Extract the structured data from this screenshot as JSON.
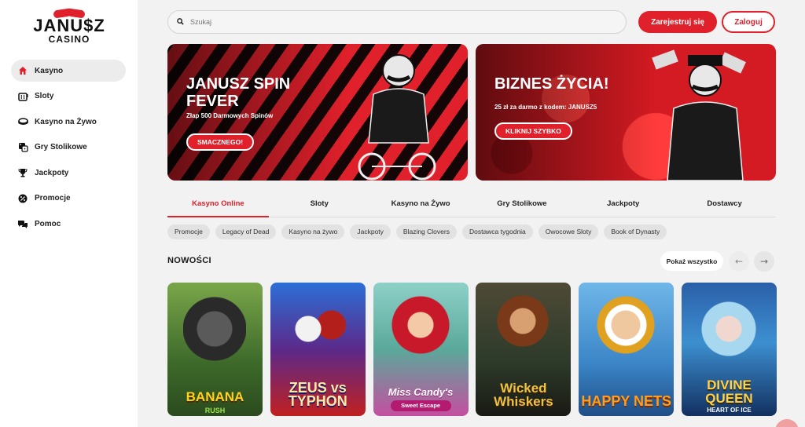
{
  "brand": {
    "line1": "JANU$Z",
    "line2": "CASINO",
    "accent": "#e0202b"
  },
  "sidebar": {
    "items": [
      {
        "label": "Kasyno",
        "icon": "home-icon",
        "active": true
      },
      {
        "label": "Sloty",
        "icon": "slot-machine-icon",
        "active": false
      },
      {
        "label": "Kasyno na Żywo",
        "icon": "live-chip-icon",
        "active": false
      },
      {
        "label": "Gry Stolikowe",
        "icon": "dice-icon",
        "active": false
      },
      {
        "label": "Jackpoty",
        "icon": "trophy-icon",
        "active": false
      },
      {
        "label": "Promocje",
        "icon": "percent-icon",
        "active": false
      },
      {
        "label": "Pomoc",
        "icon": "chat-icon",
        "active": false
      }
    ]
  },
  "header": {
    "search_placeholder": "Szukaj",
    "register_label": "Zarejestruj się",
    "login_label": "Zaloguj"
  },
  "banners": [
    {
      "title": "JANUSZ SPIN FEVER",
      "subtitle": "Złap 500 Darmowych Spinów",
      "cta": "SMACZNEGO!"
    },
    {
      "title": "BIZNES ŻYCIA!",
      "subtitle": "25 zł za darmo z kodem: JANUSZ5",
      "cta": "KLIKNIJ SZYBKO"
    }
  ],
  "tabs": [
    {
      "label": "Kasyno Online",
      "active": true
    },
    {
      "label": "Sloty",
      "active": false
    },
    {
      "label": "Kasyno na Żywo",
      "active": false
    },
    {
      "label": "Gry Stolikowe",
      "active": false
    },
    {
      "label": "Jackpoty",
      "active": false
    },
    {
      "label": "Dostawcy",
      "active": false
    }
  ],
  "chips": [
    "Promocje",
    "Legacy of Dead",
    "Kasyno na żywo",
    "Jackpoty",
    "Blazing Clovers",
    "Dostawca tygodnia",
    "Owocowe Sloty",
    "Book of Dynasty"
  ],
  "section": {
    "title": "NOWOŚCI",
    "show_all": "Pokaż wszystko",
    "prev_icon": "arrow-left-icon",
    "next_icon": "arrow-right-icon"
  },
  "games": [
    {
      "name": "BANANA",
      "sub": "RUSH"
    },
    {
      "name": "ZEUS vs TYPHON",
      "sub": ""
    },
    {
      "name": "Miss Candy's",
      "sub": "Sweet Escape"
    },
    {
      "name": "Wicked Whiskers",
      "sub": ""
    },
    {
      "name": "HAPPY NETS",
      "sub": ""
    },
    {
      "name": "DIVINE QUEEN",
      "sub": "HEART OF ICE"
    }
  ]
}
